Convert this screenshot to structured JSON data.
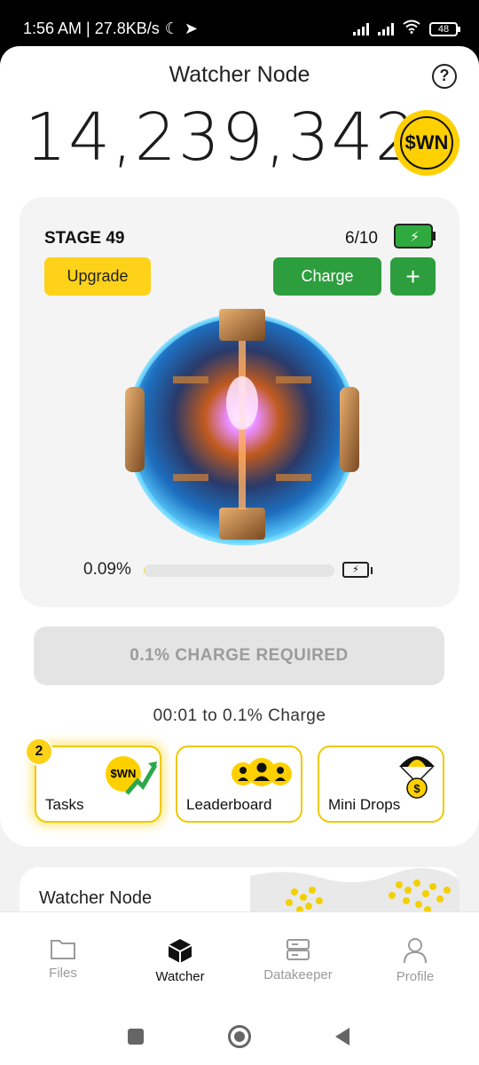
{
  "status": {
    "time_speed": "1:56 AM | 27.8KB/s",
    "battery": "48"
  },
  "header": {
    "title": "Watcher Node",
    "help_symbol": "?"
  },
  "balance": {
    "value": "14,239,342",
    "coin_label": "$WN"
  },
  "stage": {
    "label": "STAGE 49",
    "count": "6/10",
    "upgrade_label": "Upgrade",
    "charge_label": "Charge",
    "plus_label": "+",
    "progress_text": "0.09%",
    "progress_fraction": 0.0009
  },
  "action": {
    "required_label": "0.1% CHARGE REQUIRED",
    "timer_text": "00:01 to 0.1% Charge"
  },
  "tiles": [
    {
      "label": "Tasks",
      "badge": "2",
      "icon_text": "$WN"
    },
    {
      "label": "Leaderboard"
    },
    {
      "label": "Mini Drops",
      "icon_text": "$"
    }
  ],
  "bottom_card": {
    "title": "Watcher Node"
  },
  "nav": [
    {
      "label": "Files",
      "icon": "folder-icon"
    },
    {
      "label": "Watcher",
      "icon": "cube-icon",
      "active": true
    },
    {
      "label": "Datakeeper",
      "icon": "server-icon"
    },
    {
      "label": "Profile",
      "icon": "user-icon"
    }
  ],
  "colors": {
    "accent_yellow": "#ffd21a",
    "accent_green": "#2d9e3e",
    "muted_gray": "#9b9b9b"
  }
}
